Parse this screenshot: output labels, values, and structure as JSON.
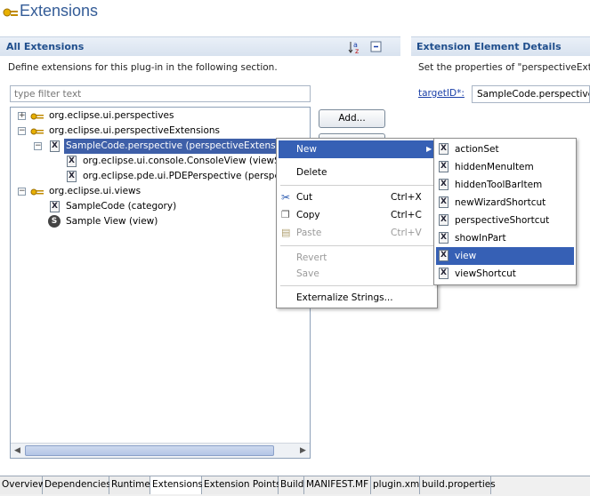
{
  "header": {
    "title": "Extensions"
  },
  "left_section": {
    "title": "All Extensions",
    "description": "Define extensions for this plug-in in the following section.",
    "filter_placeholder": "type filter text",
    "sort_icon": "sort-az-icon",
    "collapse_icon": "collapse-all-icon"
  },
  "tree": [
    {
      "label": "org.eclipse.ui.perspectives",
      "icon": "plugin-icon",
      "toggle": "+"
    },
    {
      "label": "org.eclipse.ui.perspectiveExtensions",
      "icon": "plugin-icon",
      "toggle": "-"
    },
    {
      "label": "SampleCode.perspective (perspectiveExtension)",
      "icon": "x-element-icon",
      "toggle": "-"
    },
    {
      "label": "org.eclipse.ui.console.ConsoleView (viewSho",
      "icon": "x-element-icon"
    },
    {
      "label": "org.eclipse.pde.ui.PDEPerspective (perspecti",
      "icon": "x-element-icon"
    },
    {
      "label": "org.eclipse.ui.views",
      "icon": "plugin-icon",
      "toggle": "-"
    },
    {
      "label": "SampleCode (category)",
      "icon": "x-element-icon"
    },
    {
      "label": "Sample View (view)",
      "icon": "s-view-icon"
    }
  ],
  "buttons": {
    "add": "Add..."
  },
  "right_section": {
    "title": "Extension Element Details",
    "description": "Set the properties of \"perspectiveExtens",
    "target_label": "targetID*:",
    "target_value": "SampleCode.perspective"
  },
  "context_menu": {
    "new": "New",
    "delete": "Delete",
    "cut": "Cut",
    "cut_shortcut": "Ctrl+X",
    "copy": "Copy",
    "copy_shortcut": "Ctrl+C",
    "paste": "Paste",
    "paste_shortcut": "Ctrl+V",
    "revert": "Revert",
    "save": "Save",
    "externalize": "Externalize Strings..."
  },
  "submenu": [
    "actionSet",
    "hiddenMenuItem",
    "hiddenToolBarItem",
    "newWizardShortcut",
    "perspectiveShortcut",
    "showInPart",
    "view",
    "viewShortcut"
  ],
  "submenu_selected": "view",
  "tabs": [
    "Overview",
    "Dependencies",
    "Runtime",
    "Extensions",
    "Extension Points",
    "Build",
    "MANIFEST.MF",
    "plugin.xml",
    "build.properties"
  ],
  "active_tab": "Extensions",
  "colors": {
    "title": "#345c97",
    "selection": "#3e5fa8",
    "menu_highlight": "#3660b5",
    "section_title": "#1f4e8c"
  }
}
